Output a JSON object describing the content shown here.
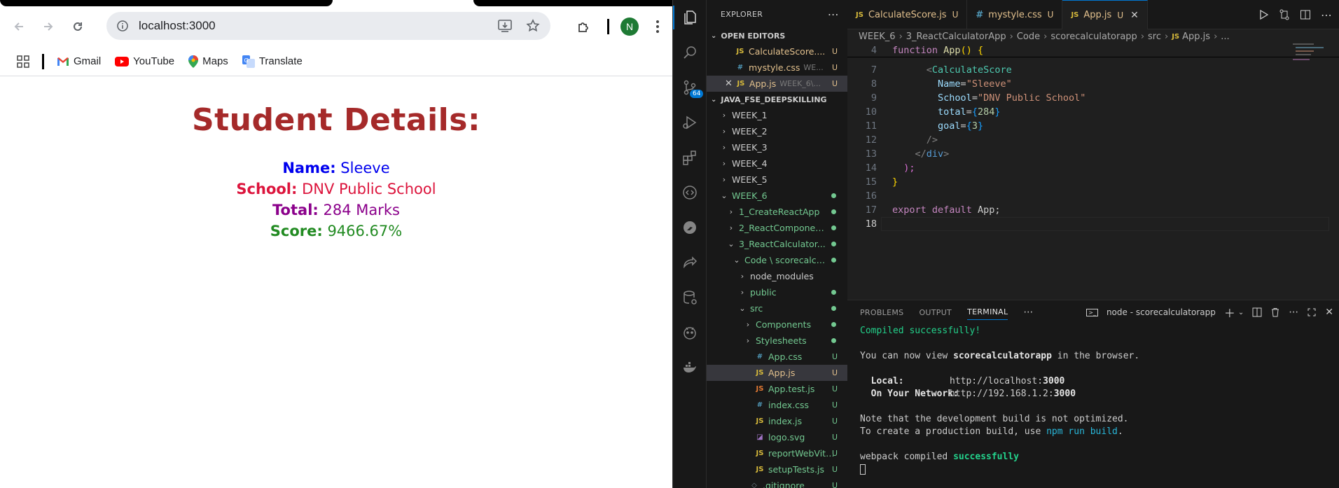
{
  "browser": {
    "url": "localhost:3000",
    "avatar_letter": "N",
    "bookmarks": [
      {
        "label": "Gmail"
      },
      {
        "label": "YouTube"
      },
      {
        "label": "Maps"
      },
      {
        "label": "Translate"
      }
    ],
    "page": {
      "heading": "Student Details:",
      "rows": [
        {
          "label": "Name:",
          "value": "Sleeve"
        },
        {
          "label": "School:",
          "value": "DNV Public School"
        },
        {
          "label": "Total:",
          "value": "284 Marks"
        },
        {
          "label": "Score:",
          "value": "9466.67%"
        }
      ]
    }
  },
  "vscode": {
    "explorer_title": "EXPLORER",
    "open_editors_title": "OPEN EDITORS",
    "open_editors": [
      {
        "type": "JS",
        "name": "CalculateScore....",
        "status": "U"
      },
      {
        "type": "#",
        "name": "mystyle.css",
        "hint": "WE...",
        "status": "U"
      },
      {
        "type": "JS",
        "name": "App.js",
        "hint": "WEEK_6\\...",
        "status": "U"
      }
    ],
    "workspace_title": "JAVA_FSE_DEEPSKILLING",
    "tree": [
      {
        "name": "WEEK_1"
      },
      {
        "name": "WEEK_2"
      },
      {
        "name": "WEEK_3"
      },
      {
        "name": "WEEK_4"
      },
      {
        "name": "WEEK_5"
      },
      {
        "name": "WEEK_6"
      },
      {
        "name": "1_CreateReactApp"
      },
      {
        "name": "2_ReactComponen..."
      },
      {
        "name": "3_ReactCalculator..."
      },
      {
        "name": "Code \\ scorecalcu..."
      },
      {
        "name": "node_modules"
      },
      {
        "name": "public"
      },
      {
        "name": "src"
      },
      {
        "name": "Components"
      },
      {
        "name": "Stylesheets"
      },
      {
        "name": "App.css",
        "status": "U"
      },
      {
        "name": "App.js",
        "status": "U"
      },
      {
        "name": "App.test.js",
        "status": "U"
      },
      {
        "name": "index.css",
        "status": "U"
      },
      {
        "name": "index.js",
        "status": "U"
      },
      {
        "name": "logo.svg",
        "status": "U"
      },
      {
        "name": "reportWebVital...",
        "status": "U"
      },
      {
        "name": "setupTests.js",
        "status": "U"
      },
      {
        "name": ".gitignore",
        "status": "U"
      }
    ],
    "scm_badge": "64",
    "tabs": [
      {
        "label": "CalculateScore.js",
        "status": "U"
      },
      {
        "label": "mystyle.css",
        "status": "U"
      },
      {
        "label": "App.js",
        "status": "U"
      }
    ],
    "breadcrumbs": [
      "WEEK_6",
      "3_ReactCalculatorApp",
      "Code",
      "scorecalculatorapp",
      "src",
      "App.js",
      "..."
    ],
    "line_numbers": [
      "4",
      "7",
      "8",
      "9",
      "10",
      "11",
      "12",
      "13",
      "14",
      "15",
      "16",
      "17",
      "18"
    ],
    "code": {
      "l4_kw": "function",
      "l4_fn": "App",
      "l4_rest": "() {",
      "l7_tag": "CalculateScore",
      "l8_attr": "Name",
      "l8_val": "\"Sleeve\"",
      "l9_attr": "School",
      "l9_val": "\"DNV Public School\"",
      "l10_attr": "total",
      "l10_val": "284",
      "l11_attr": "goal",
      "l11_val": "3",
      "l12": "/>",
      "l13_tag": "div",
      "l14": ");",
      "l15": "}",
      "l17_kw1": "export",
      "l17_kw2": "default",
      "l17_id": "App;"
    },
    "panel_tabs": [
      "PROBLEMS",
      "OUTPUT",
      "TERMINAL"
    ],
    "terminal_name": "node - scorecalculatorapp",
    "terminal": {
      "compiled": "Compiled successfully!",
      "view_prefix": "You can now view ",
      "app_name": "scorecalculatorapp",
      "view_suffix": " in the browser.",
      "local_label": "  Local:",
      "local_url_a": "http://localhost:",
      "local_port": "3000",
      "net_label": "  On Your Network:",
      "net_url_a": "http://192.168.1.2:",
      "net_port": "3000",
      "note1": "Note that the development build is not optimized.",
      "note2_prefix": "To create a production build, use ",
      "note2_cmd": "npm run build",
      "note2_suffix": ".",
      "webpack_prefix": "webpack compiled ",
      "webpack_status": "successfully"
    }
  },
  "colors": {
    "heading": "#a52a2a",
    "name": "#0000ee",
    "school": "#dc143c",
    "total": "#8b008b",
    "score": "#228b22"
  }
}
